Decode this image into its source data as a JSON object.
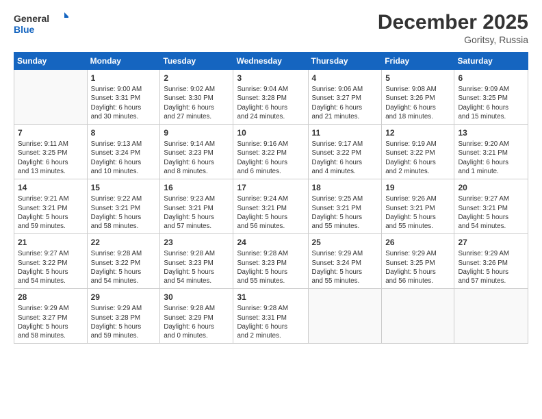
{
  "header": {
    "logo_line1": "General",
    "logo_line2": "Blue",
    "month_year": "December 2025",
    "location": "Goritsy, Russia"
  },
  "weekdays": [
    "Sunday",
    "Monday",
    "Tuesday",
    "Wednesday",
    "Thursday",
    "Friday",
    "Saturday"
  ],
  "weeks": [
    [
      {
        "day": "",
        "info": ""
      },
      {
        "day": "1",
        "info": "Sunrise: 9:00 AM\nSunset: 3:31 PM\nDaylight: 6 hours\nand 30 minutes."
      },
      {
        "day": "2",
        "info": "Sunrise: 9:02 AM\nSunset: 3:30 PM\nDaylight: 6 hours\nand 27 minutes."
      },
      {
        "day": "3",
        "info": "Sunrise: 9:04 AM\nSunset: 3:28 PM\nDaylight: 6 hours\nand 24 minutes."
      },
      {
        "day": "4",
        "info": "Sunrise: 9:06 AM\nSunset: 3:27 PM\nDaylight: 6 hours\nand 21 minutes."
      },
      {
        "day": "5",
        "info": "Sunrise: 9:08 AM\nSunset: 3:26 PM\nDaylight: 6 hours\nand 18 minutes."
      },
      {
        "day": "6",
        "info": "Sunrise: 9:09 AM\nSunset: 3:25 PM\nDaylight: 6 hours\nand 15 minutes."
      }
    ],
    [
      {
        "day": "7",
        "info": "Sunrise: 9:11 AM\nSunset: 3:25 PM\nDaylight: 6 hours\nand 13 minutes."
      },
      {
        "day": "8",
        "info": "Sunrise: 9:13 AM\nSunset: 3:24 PM\nDaylight: 6 hours\nand 10 minutes."
      },
      {
        "day": "9",
        "info": "Sunrise: 9:14 AM\nSunset: 3:23 PM\nDaylight: 6 hours\nand 8 minutes."
      },
      {
        "day": "10",
        "info": "Sunrise: 9:16 AM\nSunset: 3:22 PM\nDaylight: 6 hours\nand 6 minutes."
      },
      {
        "day": "11",
        "info": "Sunrise: 9:17 AM\nSunset: 3:22 PM\nDaylight: 6 hours\nand 4 minutes."
      },
      {
        "day": "12",
        "info": "Sunrise: 9:19 AM\nSunset: 3:22 PM\nDaylight: 6 hours\nand 2 minutes."
      },
      {
        "day": "13",
        "info": "Sunrise: 9:20 AM\nSunset: 3:21 PM\nDaylight: 6 hours\nand 1 minute."
      }
    ],
    [
      {
        "day": "14",
        "info": "Sunrise: 9:21 AM\nSunset: 3:21 PM\nDaylight: 5 hours\nand 59 minutes."
      },
      {
        "day": "15",
        "info": "Sunrise: 9:22 AM\nSunset: 3:21 PM\nDaylight: 5 hours\nand 58 minutes."
      },
      {
        "day": "16",
        "info": "Sunrise: 9:23 AM\nSunset: 3:21 PM\nDaylight: 5 hours\nand 57 minutes."
      },
      {
        "day": "17",
        "info": "Sunrise: 9:24 AM\nSunset: 3:21 PM\nDaylight: 5 hours\nand 56 minutes."
      },
      {
        "day": "18",
        "info": "Sunrise: 9:25 AM\nSunset: 3:21 PM\nDaylight: 5 hours\nand 55 minutes."
      },
      {
        "day": "19",
        "info": "Sunrise: 9:26 AM\nSunset: 3:21 PM\nDaylight: 5 hours\nand 55 minutes."
      },
      {
        "day": "20",
        "info": "Sunrise: 9:27 AM\nSunset: 3:21 PM\nDaylight: 5 hours\nand 54 minutes."
      }
    ],
    [
      {
        "day": "21",
        "info": "Sunrise: 9:27 AM\nSunset: 3:22 PM\nDaylight: 5 hours\nand 54 minutes."
      },
      {
        "day": "22",
        "info": "Sunrise: 9:28 AM\nSunset: 3:22 PM\nDaylight: 5 hours\nand 54 minutes."
      },
      {
        "day": "23",
        "info": "Sunrise: 9:28 AM\nSunset: 3:23 PM\nDaylight: 5 hours\nand 54 minutes."
      },
      {
        "day": "24",
        "info": "Sunrise: 9:28 AM\nSunset: 3:23 PM\nDaylight: 5 hours\nand 55 minutes."
      },
      {
        "day": "25",
        "info": "Sunrise: 9:29 AM\nSunset: 3:24 PM\nDaylight: 5 hours\nand 55 minutes."
      },
      {
        "day": "26",
        "info": "Sunrise: 9:29 AM\nSunset: 3:25 PM\nDaylight: 5 hours\nand 56 minutes."
      },
      {
        "day": "27",
        "info": "Sunrise: 9:29 AM\nSunset: 3:26 PM\nDaylight: 5 hours\nand 57 minutes."
      }
    ],
    [
      {
        "day": "28",
        "info": "Sunrise: 9:29 AM\nSunset: 3:27 PM\nDaylight: 5 hours\nand 58 minutes."
      },
      {
        "day": "29",
        "info": "Sunrise: 9:29 AM\nSunset: 3:28 PM\nDaylight: 5 hours\nand 59 minutes."
      },
      {
        "day": "30",
        "info": "Sunrise: 9:28 AM\nSunset: 3:29 PM\nDaylight: 6 hours\nand 0 minutes."
      },
      {
        "day": "31",
        "info": "Sunrise: 9:28 AM\nSunset: 3:31 PM\nDaylight: 6 hours\nand 2 minutes."
      },
      {
        "day": "",
        "info": ""
      },
      {
        "day": "",
        "info": ""
      },
      {
        "day": "",
        "info": ""
      }
    ]
  ]
}
